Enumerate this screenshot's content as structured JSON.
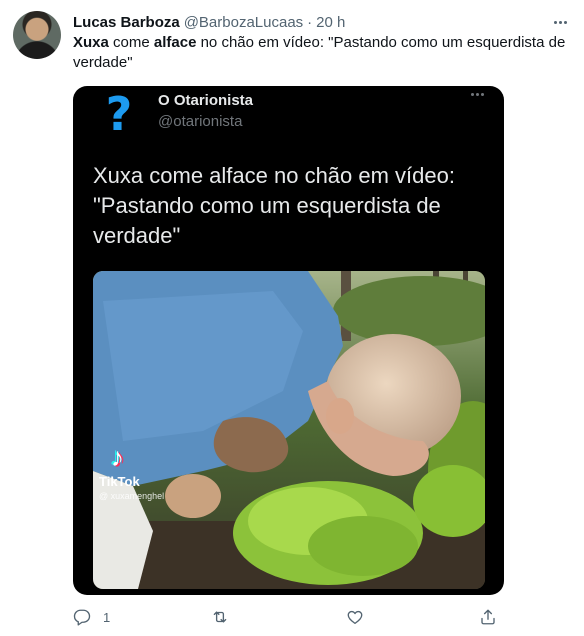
{
  "tweet": {
    "display_name": "Lucas Barboza",
    "handle": "@BarbozaLucaas",
    "separator": "·",
    "time": "20 h",
    "text_parts": [
      "Xuxa",
      " come ",
      "alface",
      " no chão em vídeo: \"Pastando como um esquerdista de verdade\""
    ]
  },
  "quoted": {
    "display_name": "O Otarionista",
    "handle": "@otarionista",
    "avatar_glyph": "?",
    "text": "Xuxa come alface no chão em vídeo: \"Pastando como um esquerdista de verdade\"",
    "watermark_brand": "TikTok",
    "watermark_user": "@ xuxamenghel"
  },
  "actions": {
    "reply_count": "1",
    "icons": [
      "reply-icon",
      "retweet-icon",
      "like-icon",
      "share-icon"
    ]
  },
  "colors": {
    "text": "#0f1419",
    "secondary": "#536471",
    "accent": "#1d9bf0",
    "media_bg": "#000000"
  }
}
